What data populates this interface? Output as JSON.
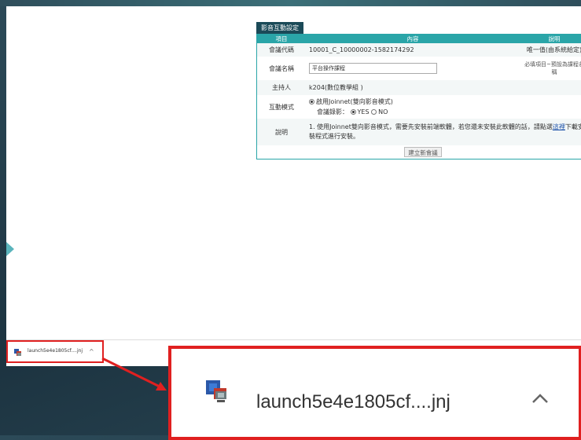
{
  "panel": {
    "tab_title": "影音互動設定",
    "headers": {
      "item": "項目",
      "content": "內容",
      "note": "說明"
    },
    "rows": {
      "code": {
        "label": "會議代碼",
        "value": "10001_C_10000002-1582174292",
        "note": "唯一值(由系統給定)"
      },
      "name": {
        "label": "會議名稱",
        "value": "平台操作課程",
        "note": "必填項目~預設為課程名稱"
      },
      "host": {
        "label": "主持人",
        "value": "k204(數位教學組 )"
      },
      "mode": {
        "label": "互動模式",
        "option": "啟用Joinnet(雙向影音模式)",
        "record_label": "會議錄影：",
        "yes": "YES",
        "no": "NO"
      },
      "desc": {
        "label": "說明",
        "text_before": "1. 使用Joinnet雙向影音模式，需要先安裝前端軟體，若您還未安裝此軟體的話，請點選",
        "link": "這裡",
        "text_after": "下載安裝程式進行安裝。"
      }
    },
    "submit_label": "建立新會議"
  },
  "download_bar": {
    "small_filename": "launch5e4e1805cf....jnj",
    "big_filename": "launch5e4e1805cf....jnj",
    "chevron_icon": "chevron-up-icon",
    "file_icon": "jnj-file-icon"
  },
  "colors": {
    "header_teal": "#2aa5a8",
    "tab_dark": "#1b4a58",
    "highlight_red": "#e02020",
    "accent": "#5ab4bc"
  }
}
